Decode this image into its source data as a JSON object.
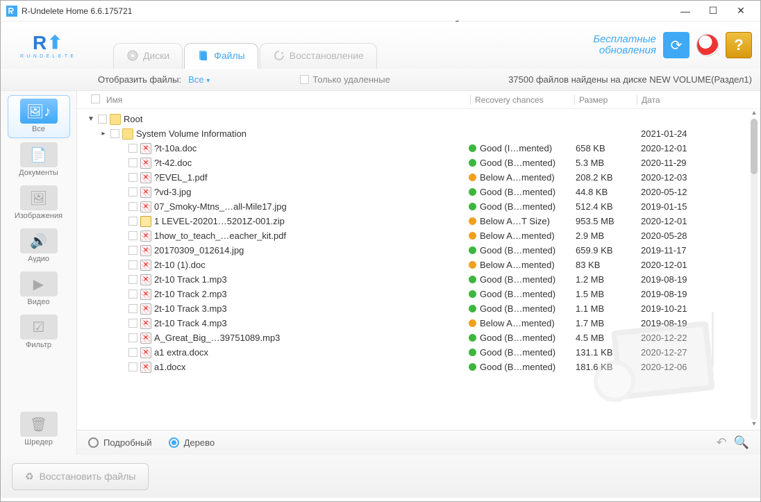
{
  "window": {
    "title": "R-Undelete Home 6.6.175721"
  },
  "header": {
    "logo_text": "R",
    "logo_sub": "R·U·N·D·E·L·E·T·E",
    "tabs": [
      {
        "label": "Диски"
      },
      {
        "label": "Файлы"
      },
      {
        "label": "Восстановление"
      }
    ],
    "updates_line1": "Бесплатные",
    "updates_line2": "обновления",
    "help": "?"
  },
  "toolbar": {
    "show_files_label": "Отобразить файлы:",
    "show_files_value": "Все",
    "only_deleted": "Только удаленные",
    "status": "37500 файлов найдены на диске NEW VOLUME(Раздел1)"
  },
  "sidebar": {
    "items": [
      {
        "label": "Все"
      },
      {
        "label": "Документы"
      },
      {
        "label": "Изображения"
      },
      {
        "label": "Аудио"
      },
      {
        "label": "Видео"
      },
      {
        "label": "Фильтр"
      }
    ],
    "shredder": "Шредер"
  },
  "columns": {
    "name": "Имя",
    "recovery": "Recovery chances",
    "size": "Размер",
    "date": "Дата"
  },
  "files": [
    {
      "indent": 0,
      "expand": "▼",
      "icon": "folder",
      "name": "Root",
      "rec": "",
      "dot": "",
      "size": "",
      "date": ""
    },
    {
      "indent": 1,
      "expand": "▸",
      "icon": "folder",
      "name": "System Volume Information",
      "rec": "",
      "dot": "",
      "size": "",
      "date": "2021-01-24"
    },
    {
      "indent": 2,
      "expand": "",
      "icon": "bad",
      "name": "?t-10a.doc",
      "rec": "Good (I…mented)",
      "dot": "green",
      "size": "658 KB",
      "date": "2020-12-01"
    },
    {
      "indent": 2,
      "expand": "",
      "icon": "bad",
      "name": "?t-42.doc",
      "rec": "Good (B…mented)",
      "dot": "green",
      "size": "5.3 MB",
      "date": "2020-11-29"
    },
    {
      "indent": 2,
      "expand": "",
      "icon": "bad",
      "name": "?EVEL_1.pdf",
      "rec": "Below A…mented)",
      "dot": "orange",
      "size": "208.2 KB",
      "date": "2020-12-03"
    },
    {
      "indent": 2,
      "expand": "",
      "icon": "bad",
      "name": "?vd-3.jpg",
      "rec": "Good (B…mented)",
      "dot": "green",
      "size": "44.8 KB",
      "date": "2020-05-12"
    },
    {
      "indent": 2,
      "expand": "",
      "icon": "bad",
      "name": "07_Smoky-Mtns_…all-Mile17.jpg",
      "rec": "Good (B…mented)",
      "dot": "green",
      "size": "512.4 KB",
      "date": "2019-01-15"
    },
    {
      "indent": 2,
      "expand": "",
      "icon": "zip",
      "name": "1 LEVEL-20201…5201Z-001.zip",
      "rec": "Below A…T Size)",
      "dot": "orange",
      "size": "953.5 MB",
      "date": "2020-12-01"
    },
    {
      "indent": 2,
      "expand": "",
      "icon": "bad",
      "name": "1how_to_teach_…eacher_kit.pdf",
      "rec": "Below A…mented)",
      "dot": "orange",
      "size": "2.9 MB",
      "date": "2020-05-28"
    },
    {
      "indent": 2,
      "expand": "",
      "icon": "bad",
      "name": "20170309_012614.jpg",
      "rec": "Good (B…mented)",
      "dot": "green",
      "size": "659.9 KB",
      "date": "2019-11-17"
    },
    {
      "indent": 2,
      "expand": "",
      "icon": "bad",
      "name": "2t-10 (1).doc",
      "rec": "Below A…mented)",
      "dot": "orange",
      "size": "83 KB",
      "date": "2020-12-01"
    },
    {
      "indent": 2,
      "expand": "",
      "icon": "bad",
      "name": "2t-10 Track 1.mp3",
      "rec": "Good (B…mented)",
      "dot": "green",
      "size": "1.2 MB",
      "date": "2019-08-19"
    },
    {
      "indent": 2,
      "expand": "",
      "icon": "bad",
      "name": "2t-10 Track 2.mp3",
      "rec": "Good (B…mented)",
      "dot": "green",
      "size": "1.5 MB",
      "date": "2019-08-19"
    },
    {
      "indent": 2,
      "expand": "",
      "icon": "bad",
      "name": "2t-10 Track 3.mp3",
      "rec": "Good (B…mented)",
      "dot": "green",
      "size": "1.1 MB",
      "date": "2019-10-21"
    },
    {
      "indent": 2,
      "expand": "",
      "icon": "bad",
      "name": "2t-10 Track 4.mp3",
      "rec": "Below A…mented)",
      "dot": "orange",
      "size": "1.7 MB",
      "date": "2019-08-19"
    },
    {
      "indent": 2,
      "expand": "",
      "icon": "bad",
      "name": "A_Great_Big_…39751089.mp3",
      "rec": "Good (B…mented)",
      "dot": "green",
      "size": "4.5 MB",
      "date": "2020-12-22"
    },
    {
      "indent": 2,
      "expand": "",
      "icon": "bad",
      "name": "a1 extra.docx",
      "rec": "Good (B…mented)",
      "dot": "green",
      "size": "131.1 KB",
      "date": "2020-12-27"
    },
    {
      "indent": 2,
      "expand": "",
      "icon": "bad",
      "name": "a1.docx",
      "rec": "Good (B…mented)",
      "dot": "green",
      "size": "181.6 KB",
      "date": "2020-12-06"
    }
  ],
  "footer": {
    "detailed": "Подробный",
    "tree": "Дерево",
    "recover": "Восстановить файлы"
  }
}
